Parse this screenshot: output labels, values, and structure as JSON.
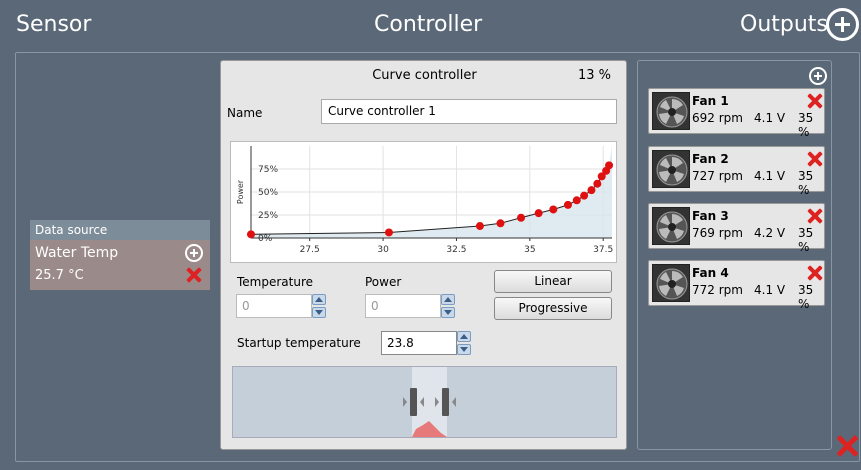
{
  "headers": {
    "sensor": "Sensor",
    "controller": "Controller",
    "outputs": "Outputs"
  },
  "sensor": {
    "title": "Data source",
    "name": "Water Temp",
    "value": "25.7 °C"
  },
  "controller": {
    "title": "Curve controller",
    "percent": "13 %",
    "name_label": "Name",
    "name_value": "Curve controller 1",
    "temperature_label": "Temperature",
    "temperature_value": "0",
    "power_label": "Power",
    "power_value": "0",
    "linear_label": "Linear",
    "progressive_label": "Progressive",
    "startup_label": "Startup temperature",
    "startup_value": "23.8"
  },
  "chart_data": {
    "type": "line",
    "ylabel": "Power",
    "xlim": [
      25.5,
      37.8
    ],
    "ylim": [
      0,
      1.0
    ],
    "xticks": [
      "27.5",
      "30",
      "32.5",
      "35",
      "37.5"
    ],
    "yticks": [
      "0%",
      "25%",
      "50%",
      "75%"
    ],
    "series": [
      {
        "x": [
          25.5,
          30.2,
          33.3,
          34.0,
          34.7,
          35.3,
          35.8,
          36.3,
          36.6,
          36.85,
          37.1,
          37.3,
          37.45,
          37.6,
          37.7
        ],
        "y": [
          0.04,
          0.06,
          0.13,
          0.16,
          0.22,
          0.27,
          0.31,
          0.36,
          0.41,
          0.46,
          0.52,
          0.59,
          0.67,
          0.73,
          0.79
        ]
      }
    ],
    "colors": {
      "line": "#222222",
      "point": "#e01010",
      "fill": "#d8e6ee"
    }
  },
  "outputs": {
    "fans": [
      {
        "name": "Fan 1",
        "rpm": "692 rpm",
        "volt": "4.1 V",
        "pct": "35 %"
      },
      {
        "name": "Fan 2",
        "rpm": "727 rpm",
        "volt": "4.1 V",
        "pct": "35 %"
      },
      {
        "name": "Fan 3",
        "rpm": "769 rpm",
        "volt": "4.2 V",
        "pct": "35 %"
      },
      {
        "name": "Fan 4",
        "rpm": "772 rpm",
        "volt": "4.1 V",
        "pct": "35 %"
      }
    ]
  },
  "colors": {
    "background": "#5b6877",
    "delete_red": "#dd2222",
    "sensor_body": "#9b8a8a"
  },
  "icons": [
    "add-circle-icon",
    "delete-x-icon",
    "fan-icon",
    "spin-up-icon",
    "spin-down-icon"
  ]
}
